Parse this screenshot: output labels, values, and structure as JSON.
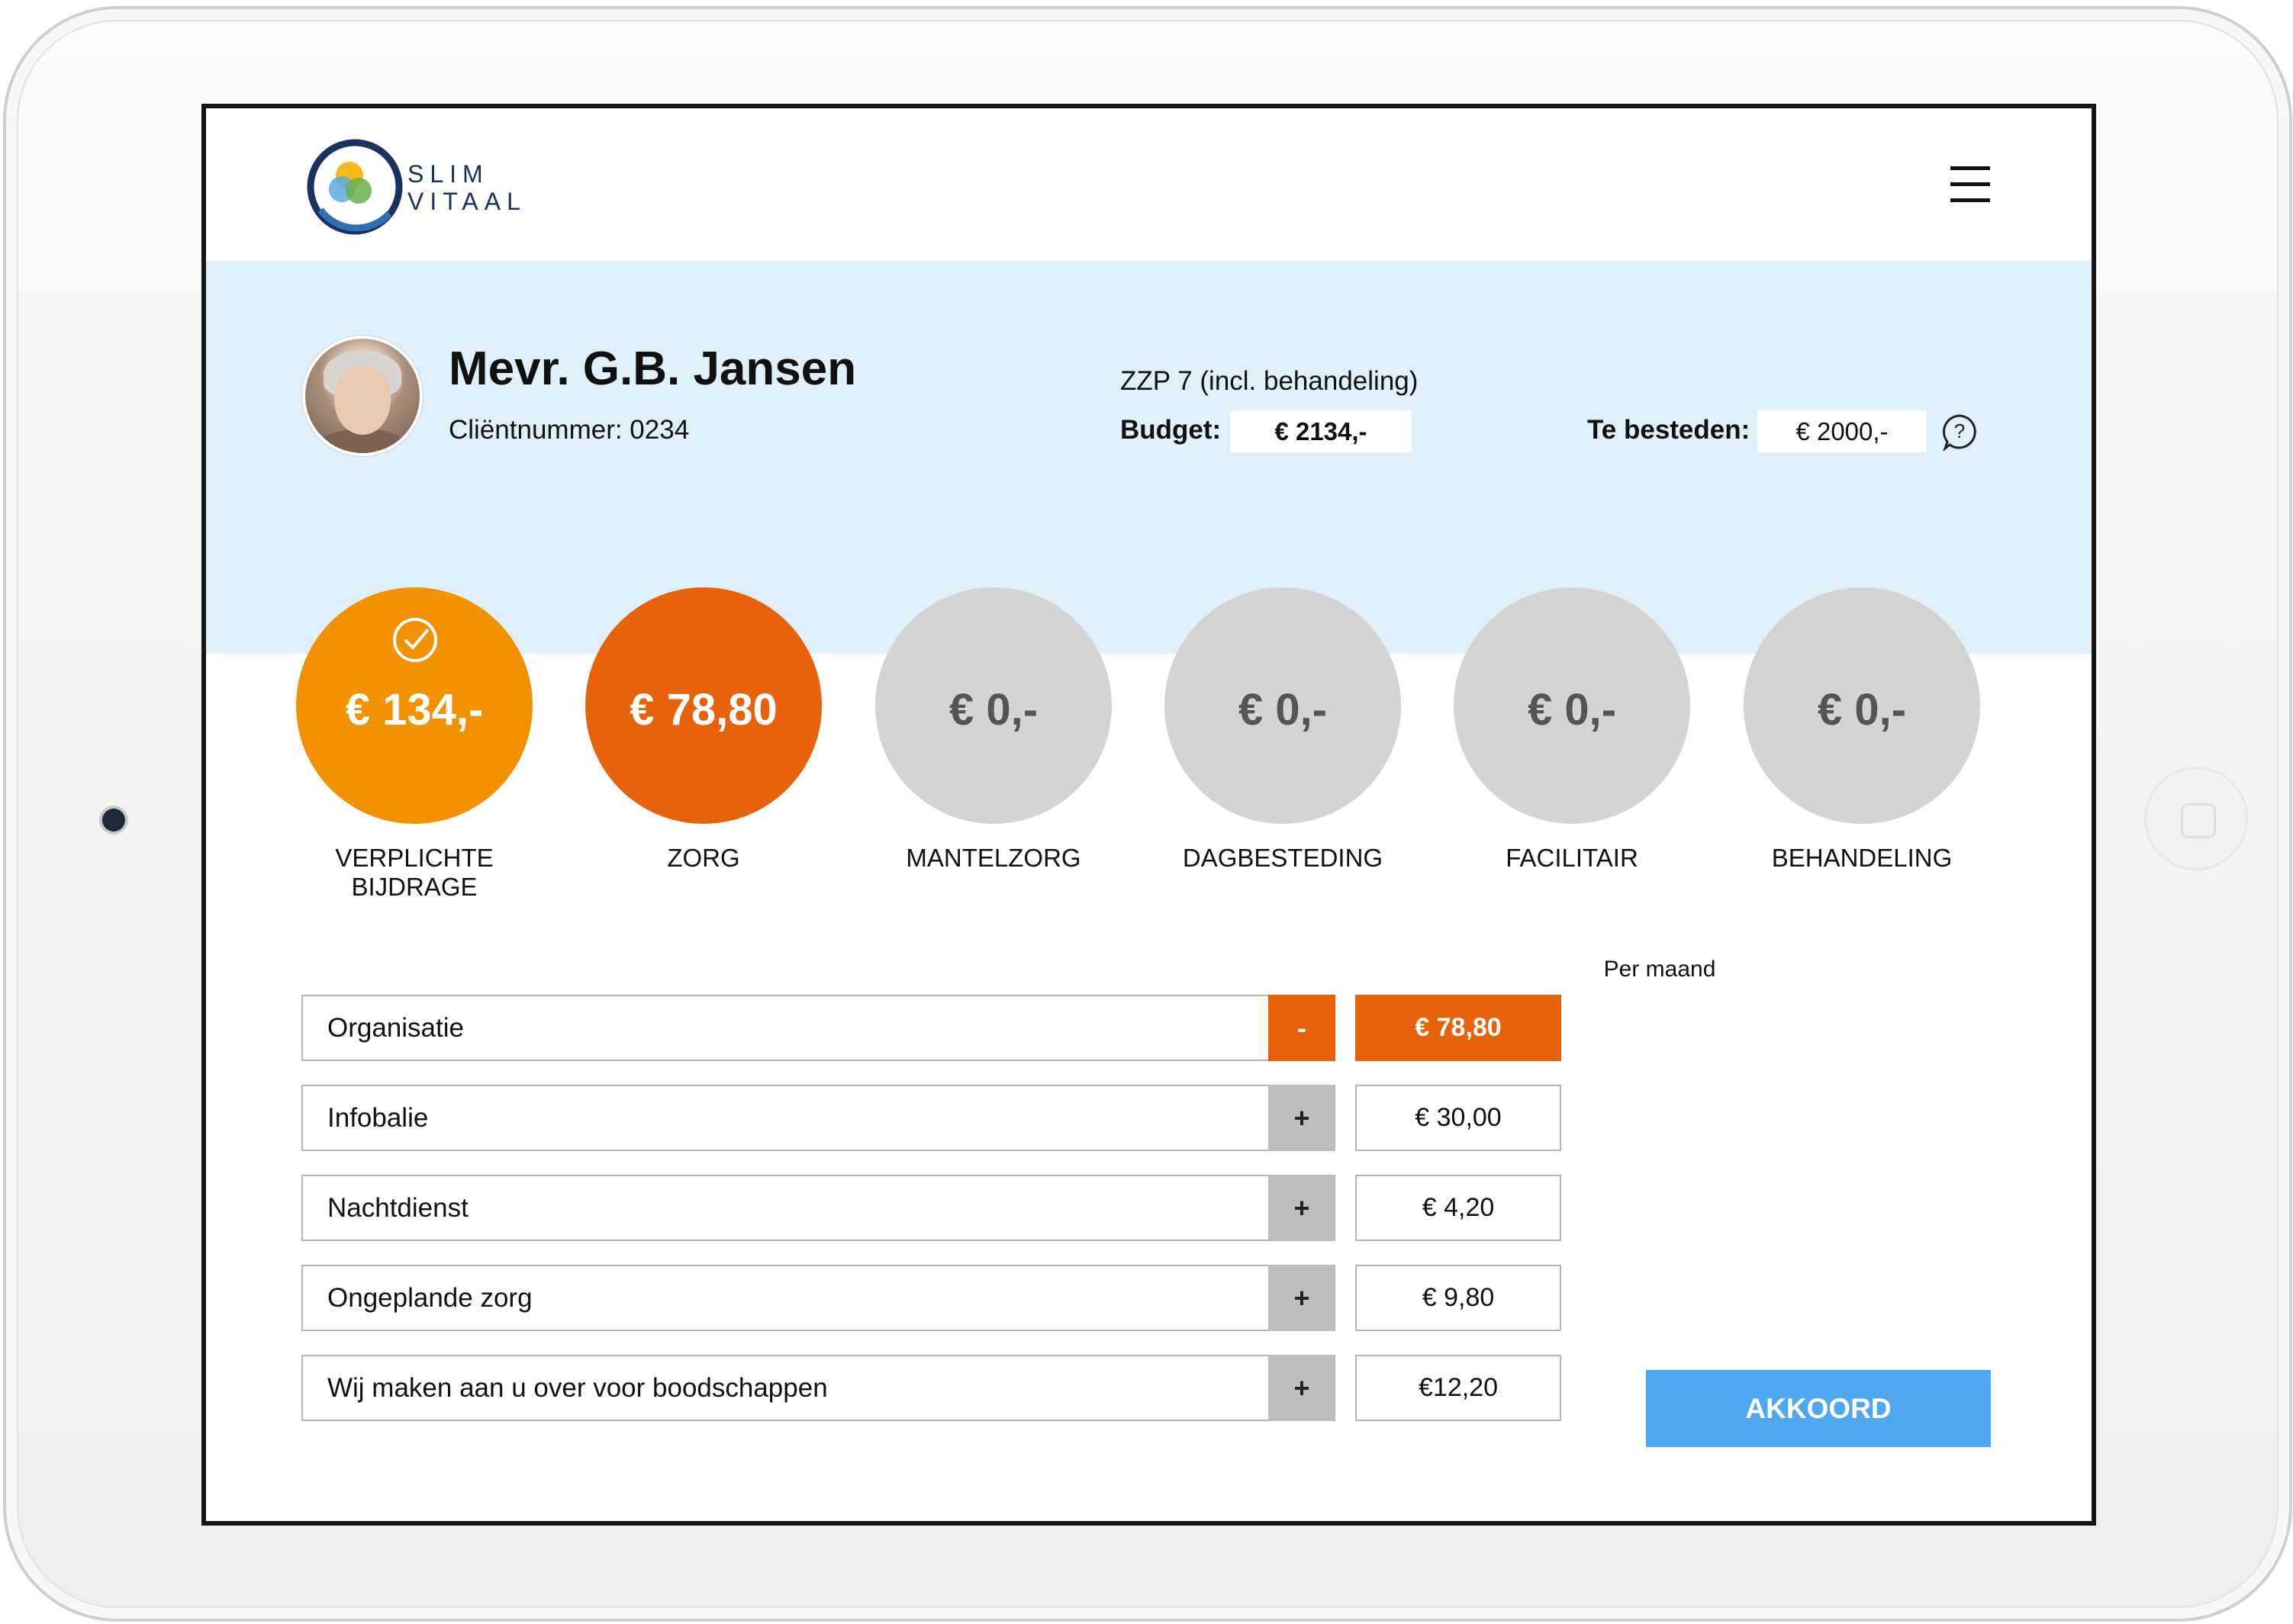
{
  "header": {
    "logo_line1": "SLIM",
    "logo_line2": "VITAAL"
  },
  "client": {
    "name": "Mevr. G.B. Jansen",
    "number_text": "Cliëntnummer: 0234",
    "zzp": "ZZP 7 (incl. behandeling)",
    "budget_label": "Budget:",
    "budget_value": "€ 2134,-",
    "te_besteden_label": "Te besteden:",
    "te_besteden_value": "€ 2000,-"
  },
  "categories": [
    {
      "label_line1": "VERPLICHTE",
      "label_line2": "BIJDRAGE",
      "value": "€ 134,-",
      "state": "done"
    },
    {
      "label_line1": "ZORG",
      "label_line2": "",
      "value": "€ 78,80",
      "state": "active"
    },
    {
      "label_line1": "MANTELZORG",
      "label_line2": "",
      "value": "€ 0,-",
      "state": "empty"
    },
    {
      "label_line1": "DAGBESTEDING",
      "label_line2": "",
      "value": "€ 0,-",
      "state": "empty"
    },
    {
      "label_line1": "FACILITAIR",
      "label_line2": "",
      "value": "€ 0,-",
      "state": "empty"
    },
    {
      "label_line1": "BEHANDELING",
      "label_line2": "",
      "value": "€ 0,-",
      "state": "empty"
    }
  ],
  "list": {
    "per_maand_label": "Per maand",
    "rows": [
      {
        "label": "Organisatie",
        "toggle": "-",
        "price": "€ 78,80",
        "selected": true
      },
      {
        "label": "Infobalie",
        "toggle": "+",
        "price": "€ 30,00",
        "selected": false
      },
      {
        "label": "Nachtdienst",
        "toggle": "+",
        "price": "€ 4,20",
        "selected": false
      },
      {
        "label": "Ongeplande zorg",
        "toggle": "+",
        "price": "€ 9,80",
        "selected": false
      },
      {
        "label": "Wij maken aan u over voor boodschappen",
        "toggle": "+",
        "price": "€12,20",
        "selected": false
      }
    ]
  },
  "actions": {
    "akkoord_label": "AKKOORD"
  },
  "colors": {
    "accent_orange": "#f39200",
    "accent_dark_orange": "#e8620b",
    "inactive_grey": "#d4d4d4",
    "band_blue": "#e0f0fb",
    "button_blue": "#4fa8ef",
    "logo_navy": "#1b3160"
  }
}
